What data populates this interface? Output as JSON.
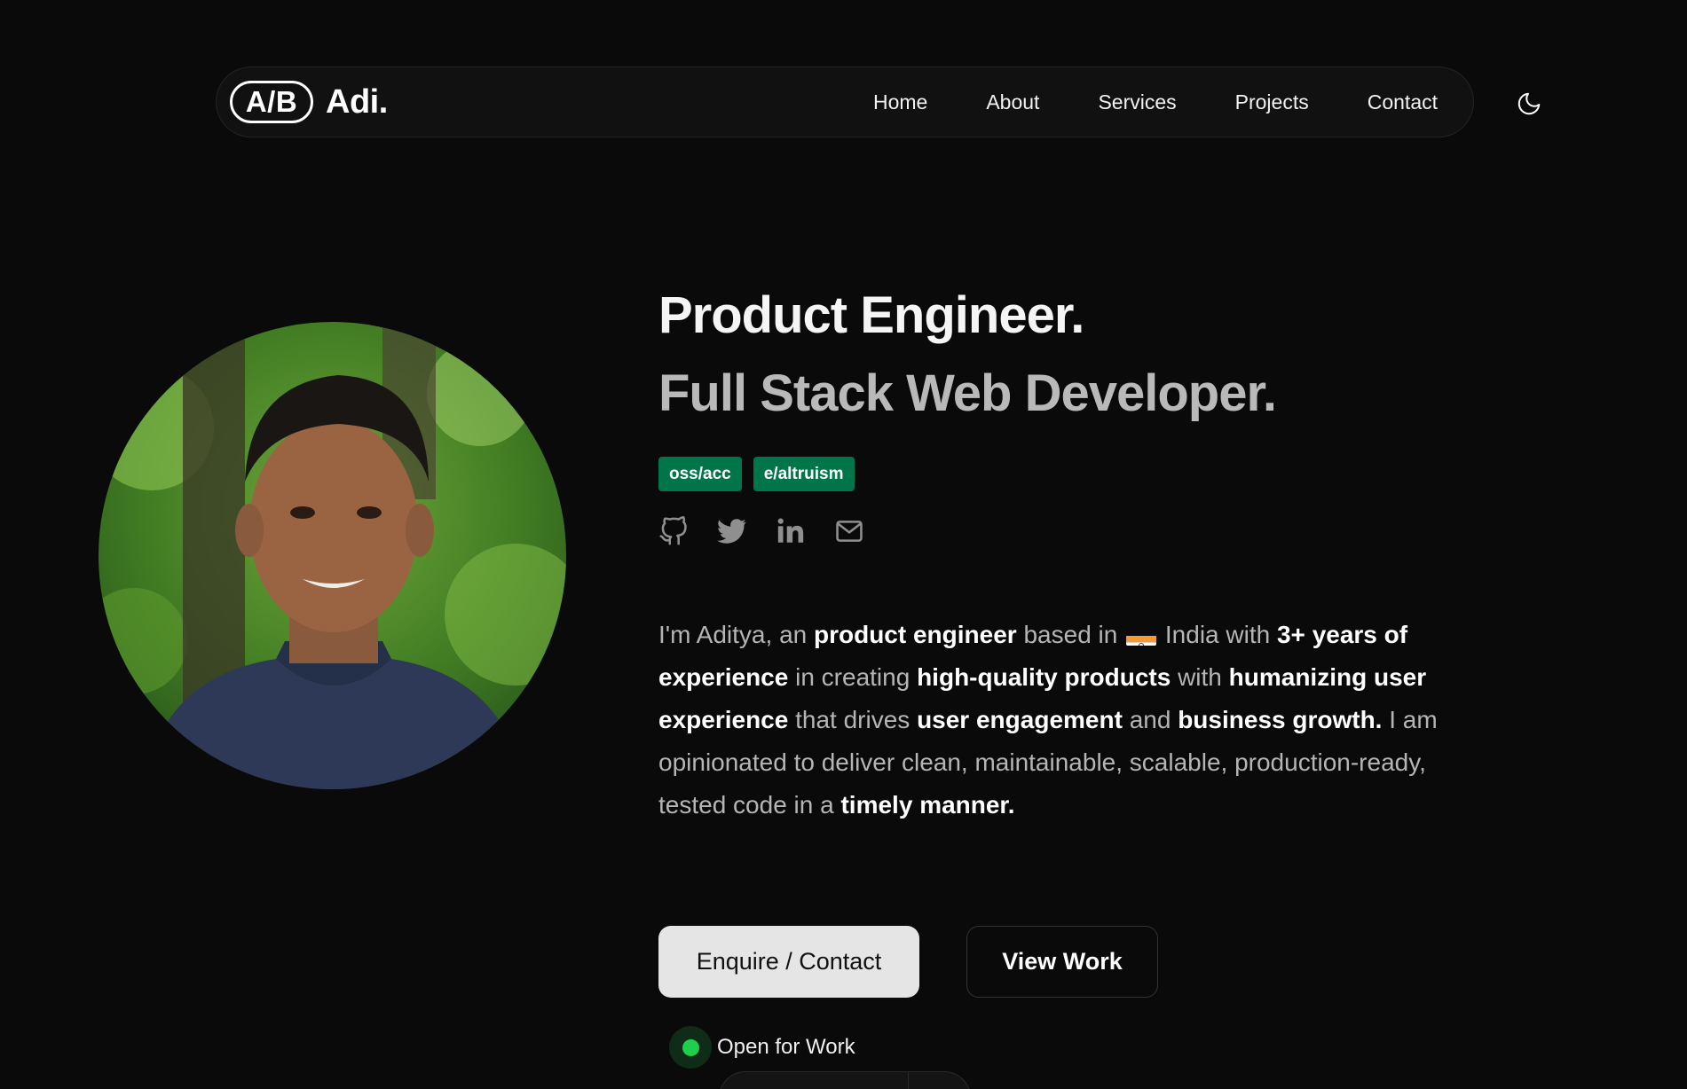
{
  "nav": {
    "logo_badge": "A/B",
    "logo_name": "Adi.",
    "links": [
      "Home",
      "About",
      "Services",
      "Projects",
      "Contact"
    ],
    "theme_icon": "moon-icon"
  },
  "hero": {
    "title_line1": "Product Engineer.",
    "title_line2": "Full Stack Web Developer.",
    "tags": [
      "oss/acc",
      "e/altruism"
    ],
    "socials": [
      "github-icon",
      "twitter-icon",
      "linkedin-icon",
      "mail-icon"
    ],
    "bio": {
      "s1": "I'm Aditya, an ",
      "b1": "product engineer",
      "s2": " based in ",
      "flag": "india-flag-icon",
      "s3": " India with ",
      "b2": "3+ years of experience",
      "s4": " in creating ",
      "b3": "high-quality products",
      "s5": " with ",
      "b4": "humanizing user experience",
      "s6": " that drives ",
      "b5": "user engagement",
      "s7": " and ",
      "b6": "business growth.",
      "s8": " I am opinionated to deliver clean, maintainable, scalable, production-ready, tested code in a ",
      "b7": "timely manner."
    },
    "primary_button": "Enquire / Contact",
    "secondary_button": "View Work",
    "status_text": "Open for Work"
  },
  "colors": {
    "background": "#0a0a0a",
    "tag": "#00754a",
    "status": "#1fce4c",
    "primary_button": "#e5e5e5"
  }
}
